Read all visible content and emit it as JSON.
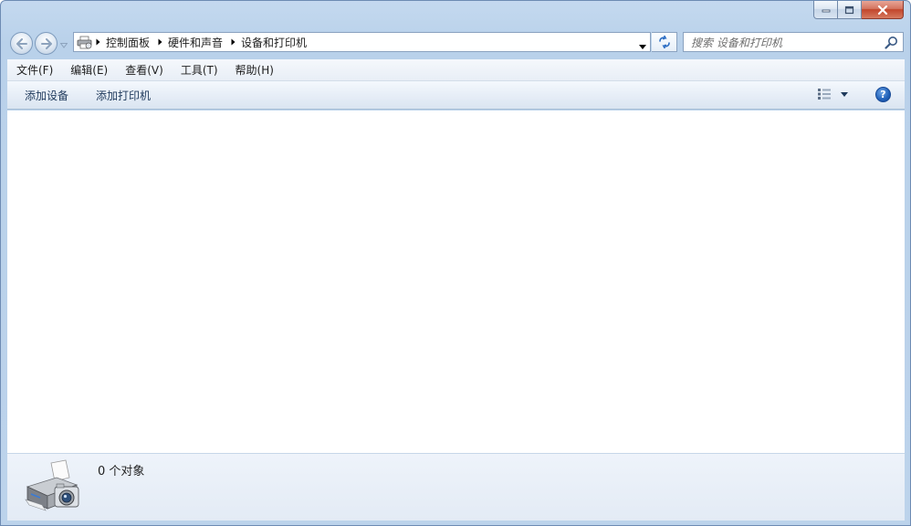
{
  "window": {
    "caption_buttons": [
      "minimize-icon",
      "maximize-icon",
      "close-icon"
    ]
  },
  "nav": {
    "back_icon": "back-arrow-icon",
    "forward_icon": "forward-arrow-icon",
    "breadcrumbs": [
      "控制面板",
      "硬件和声音",
      "设备和打印机"
    ],
    "search_placeholder": "搜索 设备和打印机"
  },
  "menu": {
    "items": [
      "文件(F)",
      "编辑(E)",
      "查看(V)",
      "工具(T)",
      "帮助(H)"
    ]
  },
  "commands": {
    "add_device": "添加设备",
    "add_printer": "添加打印机",
    "help": "?"
  },
  "details": {
    "count_text": "0 个对象"
  },
  "colors": {
    "frame": "#b9d1ea",
    "command_text": "#1e395b",
    "help_blue": "#2060b8"
  }
}
